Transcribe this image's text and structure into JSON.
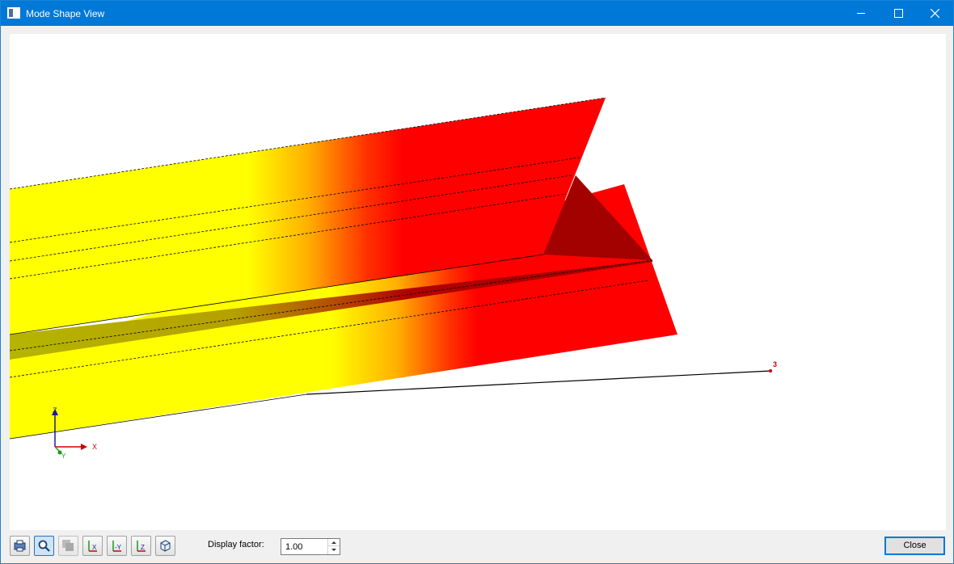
{
  "window": {
    "title": "Mode Shape View",
    "icon": "app-window-icon",
    "controls": [
      "minimize-icon",
      "maximize-icon",
      "close-icon"
    ]
  },
  "viewport": {
    "node_label": "3",
    "axes": {
      "x": "X",
      "y": "Y",
      "z": "Z"
    },
    "colors": {
      "low": "#ffff00",
      "high": "#ff0000",
      "shadow": "#b20000"
    }
  },
  "toolbar": {
    "buttons": [
      {
        "name": "print-view-button",
        "icon": "print-icon"
      },
      {
        "name": "zoom-button",
        "icon": "magnifier-icon",
        "active": true
      },
      {
        "name": "render-button",
        "icon": "render-icon",
        "disabled": true
      },
      {
        "name": "view-x-button",
        "icon": "axis-x-icon",
        "label": "X"
      },
      {
        "name": "view-minus-y-button",
        "icon": "axis-minus-y-icon",
        "label": "-Y"
      },
      {
        "name": "view-z-button",
        "icon": "axis-z-icon",
        "label": "Z"
      },
      {
        "name": "isometric-view-button",
        "icon": "isometric-icon"
      }
    ],
    "display_factor_label": "Display factor:",
    "display_factor_value": "1.00"
  },
  "footer": {
    "close_label": "Close"
  }
}
